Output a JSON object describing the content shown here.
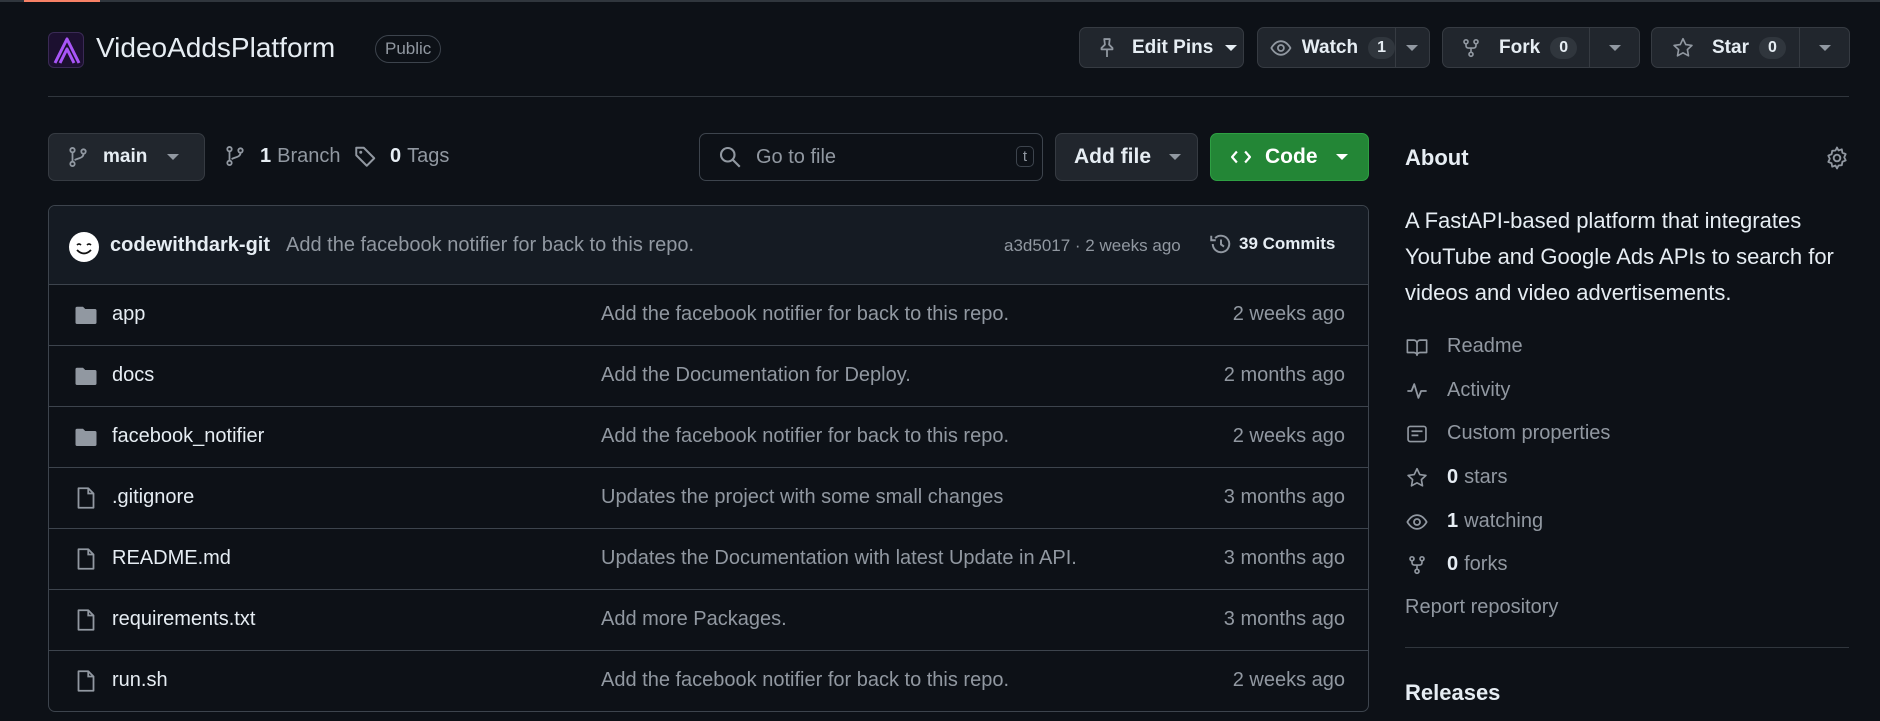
{
  "repo": {
    "name": "VideoAddsPlatform",
    "visibility": "Public"
  },
  "actions": {
    "edit_pins": "Edit Pins",
    "watch_label": "Watch",
    "watch_count": "1",
    "fork_label": "Fork",
    "fork_count": "0",
    "star_label": "Star",
    "star_count": "0"
  },
  "toolbar": {
    "branch": "main",
    "branches_count": "1",
    "branches_label": "Branch",
    "tags_count": "0",
    "tags_label": "Tags",
    "search_placeholder": "Go to file",
    "search_shortcut": "t",
    "add_file": "Add file",
    "code": "Code"
  },
  "latest_commit": {
    "author": "codewithdark-git",
    "message": "Add the facebook notifier for back to this repo.",
    "meta": "a3d5017 · 2 weeks ago",
    "commits_label": "39 Commits"
  },
  "files": [
    {
      "type": "folder",
      "name": "app",
      "message": "Add the facebook notifier for back to this repo.",
      "age": "2 weeks ago"
    },
    {
      "type": "folder",
      "name": "docs",
      "message": "Add the Documentation for Deploy.",
      "age": "2 months ago"
    },
    {
      "type": "folder",
      "name": "facebook_notifier",
      "message": "Add the facebook notifier for back to this repo.",
      "age": "2 weeks ago"
    },
    {
      "type": "file",
      "name": ".gitignore",
      "message": "Updates the project with some small changes",
      "age": "3 months ago"
    },
    {
      "type": "file",
      "name": "README.md",
      "message": "Updates the Documentation with latest Update in API.",
      "age": "3 months ago"
    },
    {
      "type": "file",
      "name": "requirements.txt",
      "message": "Add more Packages.",
      "age": "3 months ago"
    },
    {
      "type": "file",
      "name": "run.sh",
      "message": "Add the facebook notifier for back to this repo.",
      "age": "2 weeks ago"
    }
  ],
  "about": {
    "title": "About",
    "description": "A FastAPI-based platform that integrates YouTube and Google Ads APIs to search for videos and video advertisements.",
    "readme": "Readme",
    "activity": "Activity",
    "custom_properties": "Custom properties",
    "stars_count": "0",
    "stars_label": "stars",
    "watching_count": "1",
    "watching_label": "watching",
    "forks_count": "0",
    "forks_label": "forks",
    "report": "Report repository"
  },
  "releases": {
    "title": "Releases"
  },
  "colors": {
    "accent_green": "#238636",
    "logo_purple": "#9d4edd",
    "background": "#0d1117"
  }
}
